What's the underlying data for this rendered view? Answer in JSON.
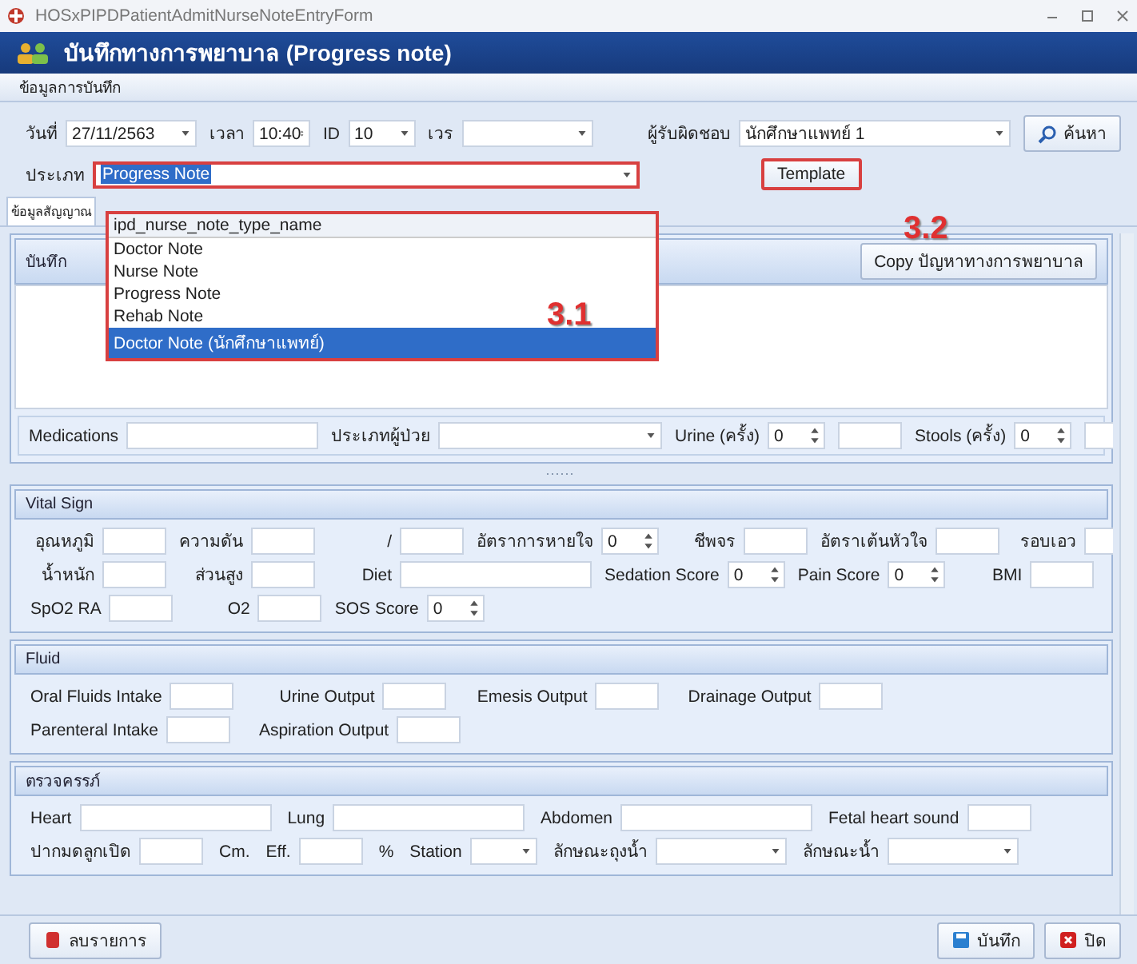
{
  "window": {
    "title": "HOSxPIPDPatientAdmitNurseNoteEntryForm"
  },
  "header": {
    "title": "บันทึกทางการพยาบาล (Progress note)"
  },
  "record_section": {
    "title": "ข้อมูลการบันทึก",
    "row": [
      {
        "kind": "combo",
        "label": "วันที่",
        "value": "27/11/2563"
      },
      {
        "kind": "spin",
        "label": "เวลา",
        "value": "10:40"
      },
      {
        "kind": "short-combo",
        "label": "ID",
        "value": "10"
      },
      {
        "kind": "combo",
        "label": "เวร"
      }
    ],
    "responsible": {
      "kind": "wide-combo",
      "label": "ผู้รับผิดชอบ",
      "value": "นักศึกษาแพทย์ 1"
    },
    "search_button": "ค้นหา",
    "type_field": {
      "label": "ประเภท",
      "value": "Progress Note",
      "highlighted": true
    },
    "template_button": {
      "label": "Template",
      "highlighted": true
    }
  },
  "dropdown": {
    "header": "ipd_nurse_note_type_name",
    "highlighted": true,
    "options": [
      {
        "label": "Doctor Note",
        "selected": false
      },
      {
        "label": "Nurse Note",
        "selected": false
      },
      {
        "label": "Progress Note",
        "selected": false
      },
      {
        "label": "Rehab Note",
        "selected": false
      },
      {
        "label": "Doctor Note (นักศึกษาแพทย์)",
        "selected": true
      }
    ]
  },
  "annotations": [
    "3.1",
    "3.2"
  ],
  "tabs": [
    {
      "label": "ข้อมูลสัญญาณ",
      "selected": true
    }
  ],
  "note_panel": {
    "title": "บันทึก",
    "copy_button": "Copy ปัญหาทางการพยาบาล",
    "fields": [
      {
        "kind": "wide-text",
        "label": "Medications"
      },
      {
        "kind": "long-combo",
        "label": "ประเภทผู้ป่วย"
      },
      {
        "kind": "spin",
        "label": "Urine (ครั้ง)",
        "value": "0"
      },
      {
        "kind": "text"
      },
      {
        "kind": "spin",
        "label": "Stools (ครั้ง)",
        "value": "0"
      },
      {
        "kind": "text"
      }
    ]
  },
  "panels": [
    {
      "title": "Vital Sign",
      "lines": [
        {
          "fields": [
            {
              "kind": "text",
              "label": "อุณหภูมิ"
            },
            {
              "kind": "text",
              "label": "ความดัน"
            },
            {
              "kind": "text",
              "label": "/"
            },
            {
              "kind": "spin",
              "label": "อัตราการหายใจ",
              "value": "0"
            },
            {
              "kind": "text",
              "label": "ชีพจร"
            },
            {
              "kind": "text",
              "label": "อัตราเต้นหัวใจ"
            },
            {
              "kind": "text",
              "label": "รอบเอว"
            }
          ]
        },
        {
          "fields": [
            {
              "kind": "text",
              "label": "น้ำหนัก"
            },
            {
              "kind": "text",
              "label": "ส่วนสูง"
            },
            {
              "kind": "wide-text",
              "label": "Diet"
            },
            {
              "kind": "spin",
              "label": "Sedation Score",
              "value": "0"
            },
            {
              "kind": "spin",
              "label": "Pain Score",
              "value": "0"
            },
            {
              "kind": "text",
              "label": "BMI"
            }
          ]
        },
        {
          "fields": [
            {
              "kind": "text",
              "label": "SpO2 RA"
            },
            {
              "kind": "text",
              "label": "O2"
            },
            {
              "kind": "spin",
              "label": "SOS Score",
              "value": "0"
            }
          ]
        }
      ]
    },
    {
      "title": "Fluid",
      "lines": [
        {
          "fields": [
            {
              "kind": "text",
              "label": "Oral Fluids Intake"
            },
            {
              "kind": "text",
              "label": "Urine Output"
            },
            {
              "kind": "text",
              "label": "Emesis Output"
            },
            {
              "kind": "text",
              "label": "Drainage Output"
            }
          ]
        },
        {
          "fields": [
            {
              "kind": "text",
              "label": "Parenteral Intake"
            },
            {
              "kind": "text",
              "label": "Aspiration Output"
            }
          ]
        }
      ]
    },
    {
      "title": "ตรวจครรภ์",
      "lines": [
        {
          "fields": [
            {
              "kind": "wide-text",
              "label": "Heart"
            },
            {
              "kind": "wide-text",
              "label": "Lung"
            },
            {
              "kind": "wide-text",
              "label": "Abdomen"
            },
            {
              "kind": "text",
              "label": "Fetal heart sound"
            }
          ]
        },
        {
          "fields": [
            {
              "kind": "text",
              "label": "ปากมดลูกเปิด"
            },
            {
              "kind": "unit",
              "label": "Cm."
            },
            {
              "kind": "text",
              "label": "Eff."
            },
            {
              "kind": "unit",
              "label": "%"
            },
            {
              "kind": "short-combo",
              "label": "Station"
            },
            {
              "kind": "combo",
              "label": "ลักษณะถุงน้ำ"
            },
            {
              "kind": "combo",
              "label": "ลักษณะน้ำ"
            }
          ]
        }
      ]
    }
  ],
  "footer": {
    "delete_button": "ลบรายการ",
    "save_button": "บันทึก",
    "close_button": "ปิด"
  }
}
